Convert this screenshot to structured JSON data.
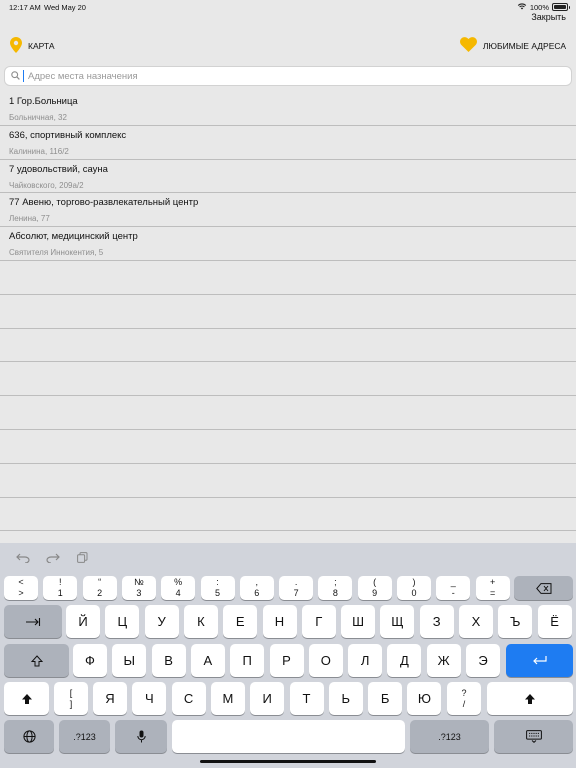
{
  "status": {
    "time": "12:17 AM",
    "date": "Wed May 20",
    "battery": "100%"
  },
  "header": {
    "close": "Закрыть",
    "map_label": "КАРТА",
    "fav_label": "ЛЮБИМЫЕ АДРЕСА"
  },
  "search": {
    "placeholder": "Адрес места назначения",
    "value": ""
  },
  "colors": {
    "accent": "#f5b800",
    "cursor": "#1e7cf2"
  },
  "results": [
    {
      "name": "1 Гор.Больница",
      "addr": "Больничная, 32"
    },
    {
      "name": "636, спортивный комплекс",
      "addr": "Калинина, 116/2"
    },
    {
      "name": "7 удовольствий, сауна",
      "addr": "Чайковского, 209а/2"
    },
    {
      "name": "77 Авеню, торгово-развлекательный центр",
      "addr": "Ленина, 77"
    },
    {
      "name": "Абсолют, медицинский центр",
      "addr": "Святителя Иннокентия, 5"
    }
  ],
  "keyboard": {
    "numbers": [
      {
        "top": "<",
        "bottom": ">"
      },
      {
        "top": "!",
        "bottom": "1"
      },
      {
        "top": "“",
        "bottom": "2"
      },
      {
        "top": "№",
        "bottom": "3"
      },
      {
        "top": "%",
        "bottom": "4"
      },
      {
        "top": ":",
        "bottom": "5"
      },
      {
        "top": ",",
        "bottom": "6"
      },
      {
        "top": ".",
        "bottom": "7"
      },
      {
        "top": ";",
        "bottom": "8"
      },
      {
        "top": "(",
        "bottom": "9"
      },
      {
        "top": ")",
        "bottom": "0"
      },
      {
        "top": "_",
        "bottom": "-"
      },
      {
        "top": "+",
        "bottom": "="
      }
    ],
    "row1": [
      "Й",
      "Ц",
      "У",
      "К",
      "Е",
      "Н",
      "Г",
      "Ш",
      "Щ",
      "З",
      "Х",
      "Ъ",
      "Ё"
    ],
    "row2": [
      "Ф",
      "Ы",
      "В",
      "А",
      "П",
      "Р",
      "О",
      "Л",
      "Д",
      "Ж",
      "Э"
    ],
    "row3_bracket": {
      "top": "[",
      "bottom": "]"
    },
    "row3": [
      "Я",
      "Ч",
      "С",
      "М",
      "И",
      "Т",
      "Ь",
      "Б",
      "Ю"
    ],
    "row3_question": {
      "top": "?",
      "bottom": "/"
    },
    "num_label": ".?123"
  }
}
